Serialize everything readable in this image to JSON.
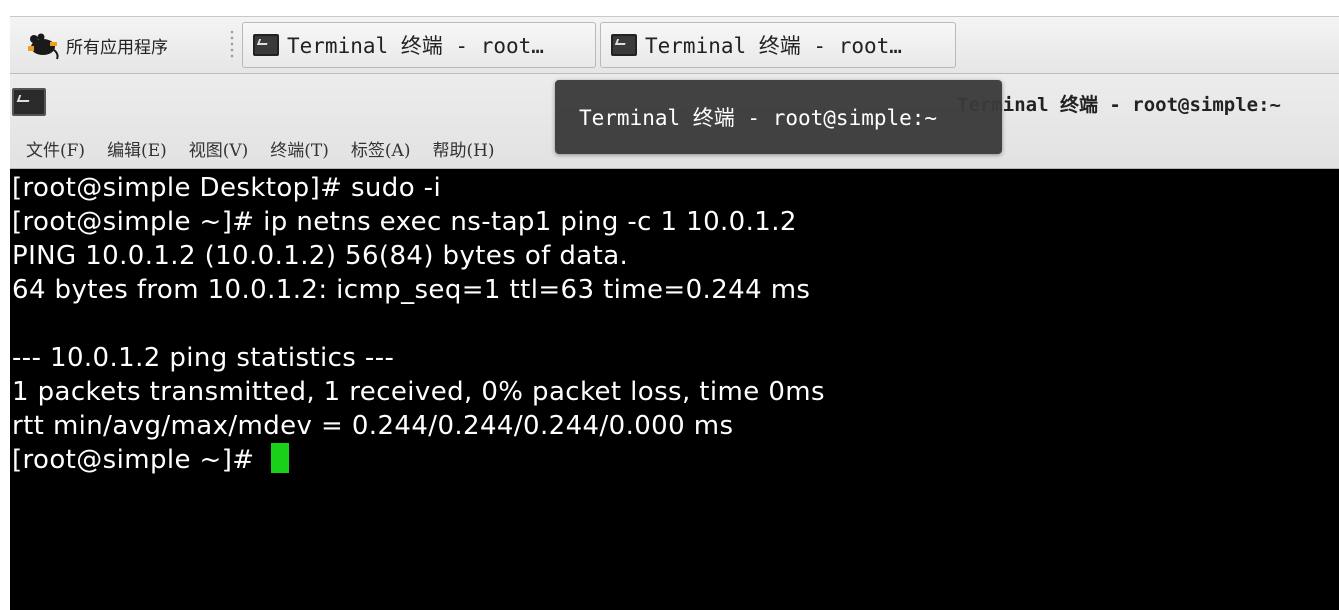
{
  "taskbar": {
    "apps_menu_label": "所有应用程序",
    "apps_icon": "mouse-logo-icon",
    "tasks": [
      {
        "label": "Terminal 终端 - root…",
        "icon": "terminal-icon"
      },
      {
        "label": "Terminal 终端 - root…",
        "icon": "terminal-icon"
      }
    ]
  },
  "window": {
    "title": "Terminal 终端 - root@simple:~",
    "icon": "terminal-icon",
    "menu": [
      "文件(F)",
      "编辑(E)",
      "视图(V)",
      "终端(T)",
      "标签(A)",
      "帮助(H)"
    ]
  },
  "tooltip": {
    "text": "Terminal 终端 - root@simple:~"
  },
  "terminal": {
    "lines": [
      "[root@simple Desktop]# sudo -i",
      "[root@simple ~]# ip netns exec ns-tap1 ping -c 1 10.0.1.2",
      "PING 10.0.1.2 (10.0.1.2) 56(84) bytes of data.",
      "64 bytes from 10.0.1.2: icmp_seq=1 ttl=63 time=0.244 ms",
      "",
      "--- 10.0.1.2 ping statistics ---",
      "1 packets transmitted, 1 received, 0% packet loss, time 0ms",
      "rtt min/avg/max/mdev = 0.244/0.244/0.244/0.000 ms",
      "[root@simple ~]# "
    ],
    "cursor_color": "#19d119",
    "background": "#000000",
    "foreground": "#ffffff"
  }
}
